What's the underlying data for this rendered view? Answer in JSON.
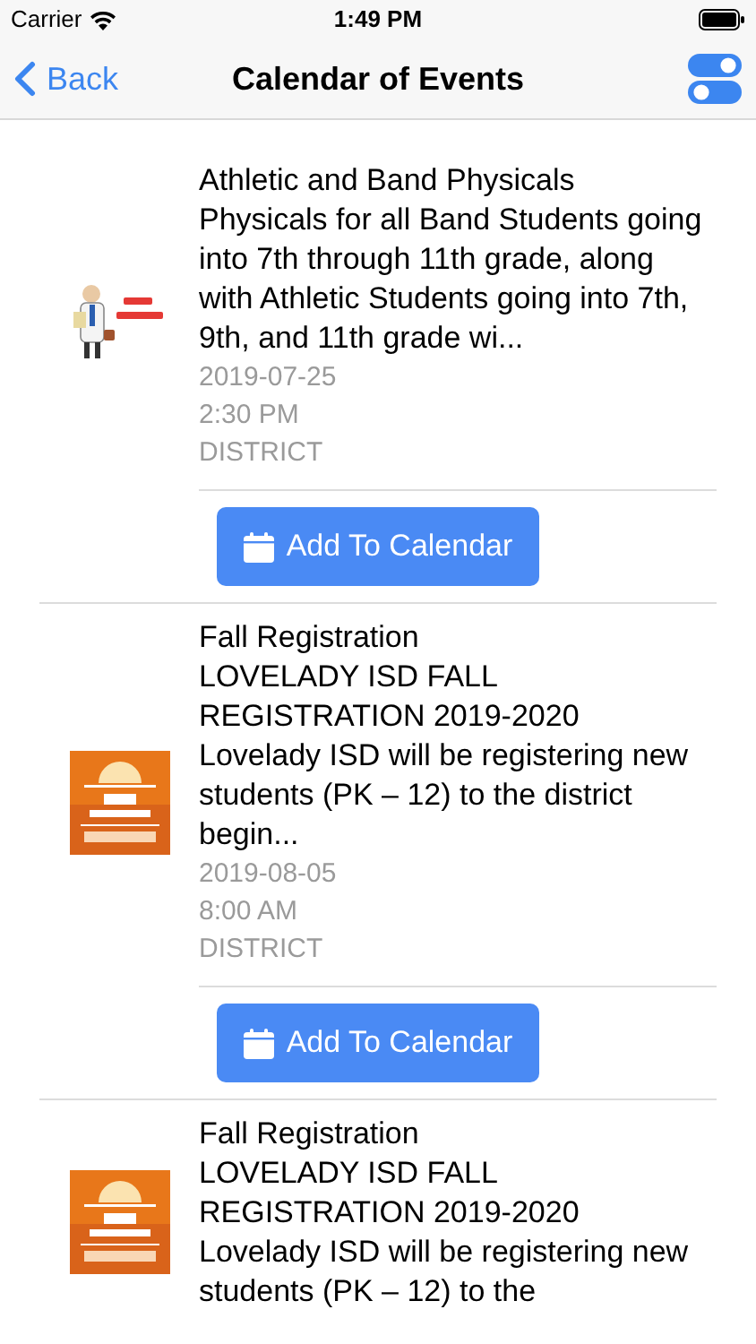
{
  "status_bar": {
    "carrier": "Carrier",
    "time": "1:49 PM"
  },
  "nav": {
    "back": "Back",
    "title": "Calendar of Events"
  },
  "events": [
    {
      "title": "Athletic and Band Physicals",
      "description": "Physicals for all Band Students going into 7th through 11th grade, along with Athletic Students going into 7th, 9th, and 11th grade wi...",
      "date": "2019-07-25",
      "time": "2:30 PM",
      "category": "DISTRICT",
      "button": "Add To Calendar"
    },
    {
      "title": "Fall Registration",
      "description": "LOVELADY ISD FALL REGISTRATION 2019-2020 Lovelady ISD will be registering new students (PK – 12) to the district begin...",
      "date": "2019-08-05",
      "time": "8:00 AM",
      "category": "DISTRICT",
      "button": "Add To Calendar"
    },
    {
      "title": "Fall Registration",
      "description": "LOVELADY ISD FALL REGISTRATION 2019-2020 Lovelady ISD will be registering new students (PK – 12) to the"
    }
  ]
}
